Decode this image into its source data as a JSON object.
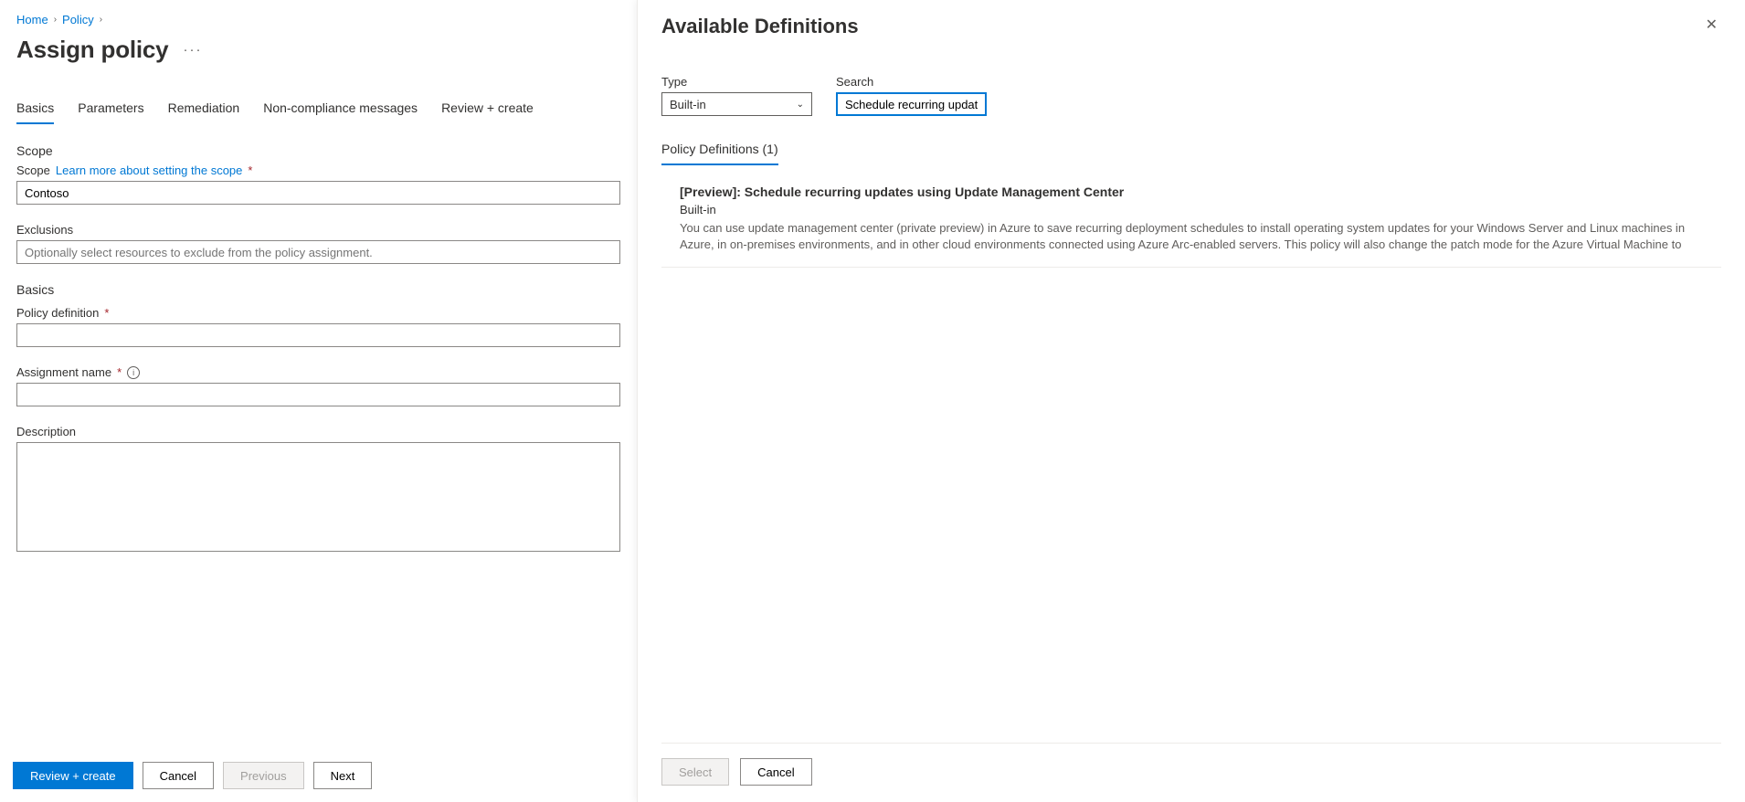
{
  "breadcrumb": {
    "home": "Home",
    "policy": "Policy"
  },
  "page": {
    "title": "Assign policy"
  },
  "tabs": [
    "Basics",
    "Parameters",
    "Remediation",
    "Non-compliance messages",
    "Review + create"
  ],
  "scope": {
    "heading": "Scope",
    "label": "Scope",
    "learn_link": "Learn more about setting the scope",
    "value": "Contoso",
    "exclusions_label": "Exclusions",
    "exclusions_placeholder": "Optionally select resources to exclude from the policy assignment."
  },
  "basics": {
    "heading": "Basics",
    "policy_def_label": "Policy definition",
    "assignment_name_label": "Assignment name",
    "description_label": "Description"
  },
  "footer": {
    "review": "Review + create",
    "cancel": "Cancel",
    "previous": "Previous",
    "next": "Next"
  },
  "panel": {
    "title": "Available Definitions",
    "type_label": "Type",
    "type_value": "Built-in",
    "search_label": "Search",
    "search_value": "Schedule recurring updat",
    "tab_label": "Policy Definitions (1)",
    "definition": {
      "name": "[Preview]: Schedule recurring updates using Update Management Center",
      "type": "Built-in",
      "desc": "You can use update management center (private preview) in Azure to save recurring deployment schedules to install operating system updates for your Windows Server and Linux machines in Azure, in on-premises environments, and in other cloud environments connected using Azure Arc-enabled servers. This policy will also change the patch mode for the Azure Virtual Machine to"
    },
    "footer": {
      "select": "Select",
      "cancel": "Cancel"
    }
  }
}
